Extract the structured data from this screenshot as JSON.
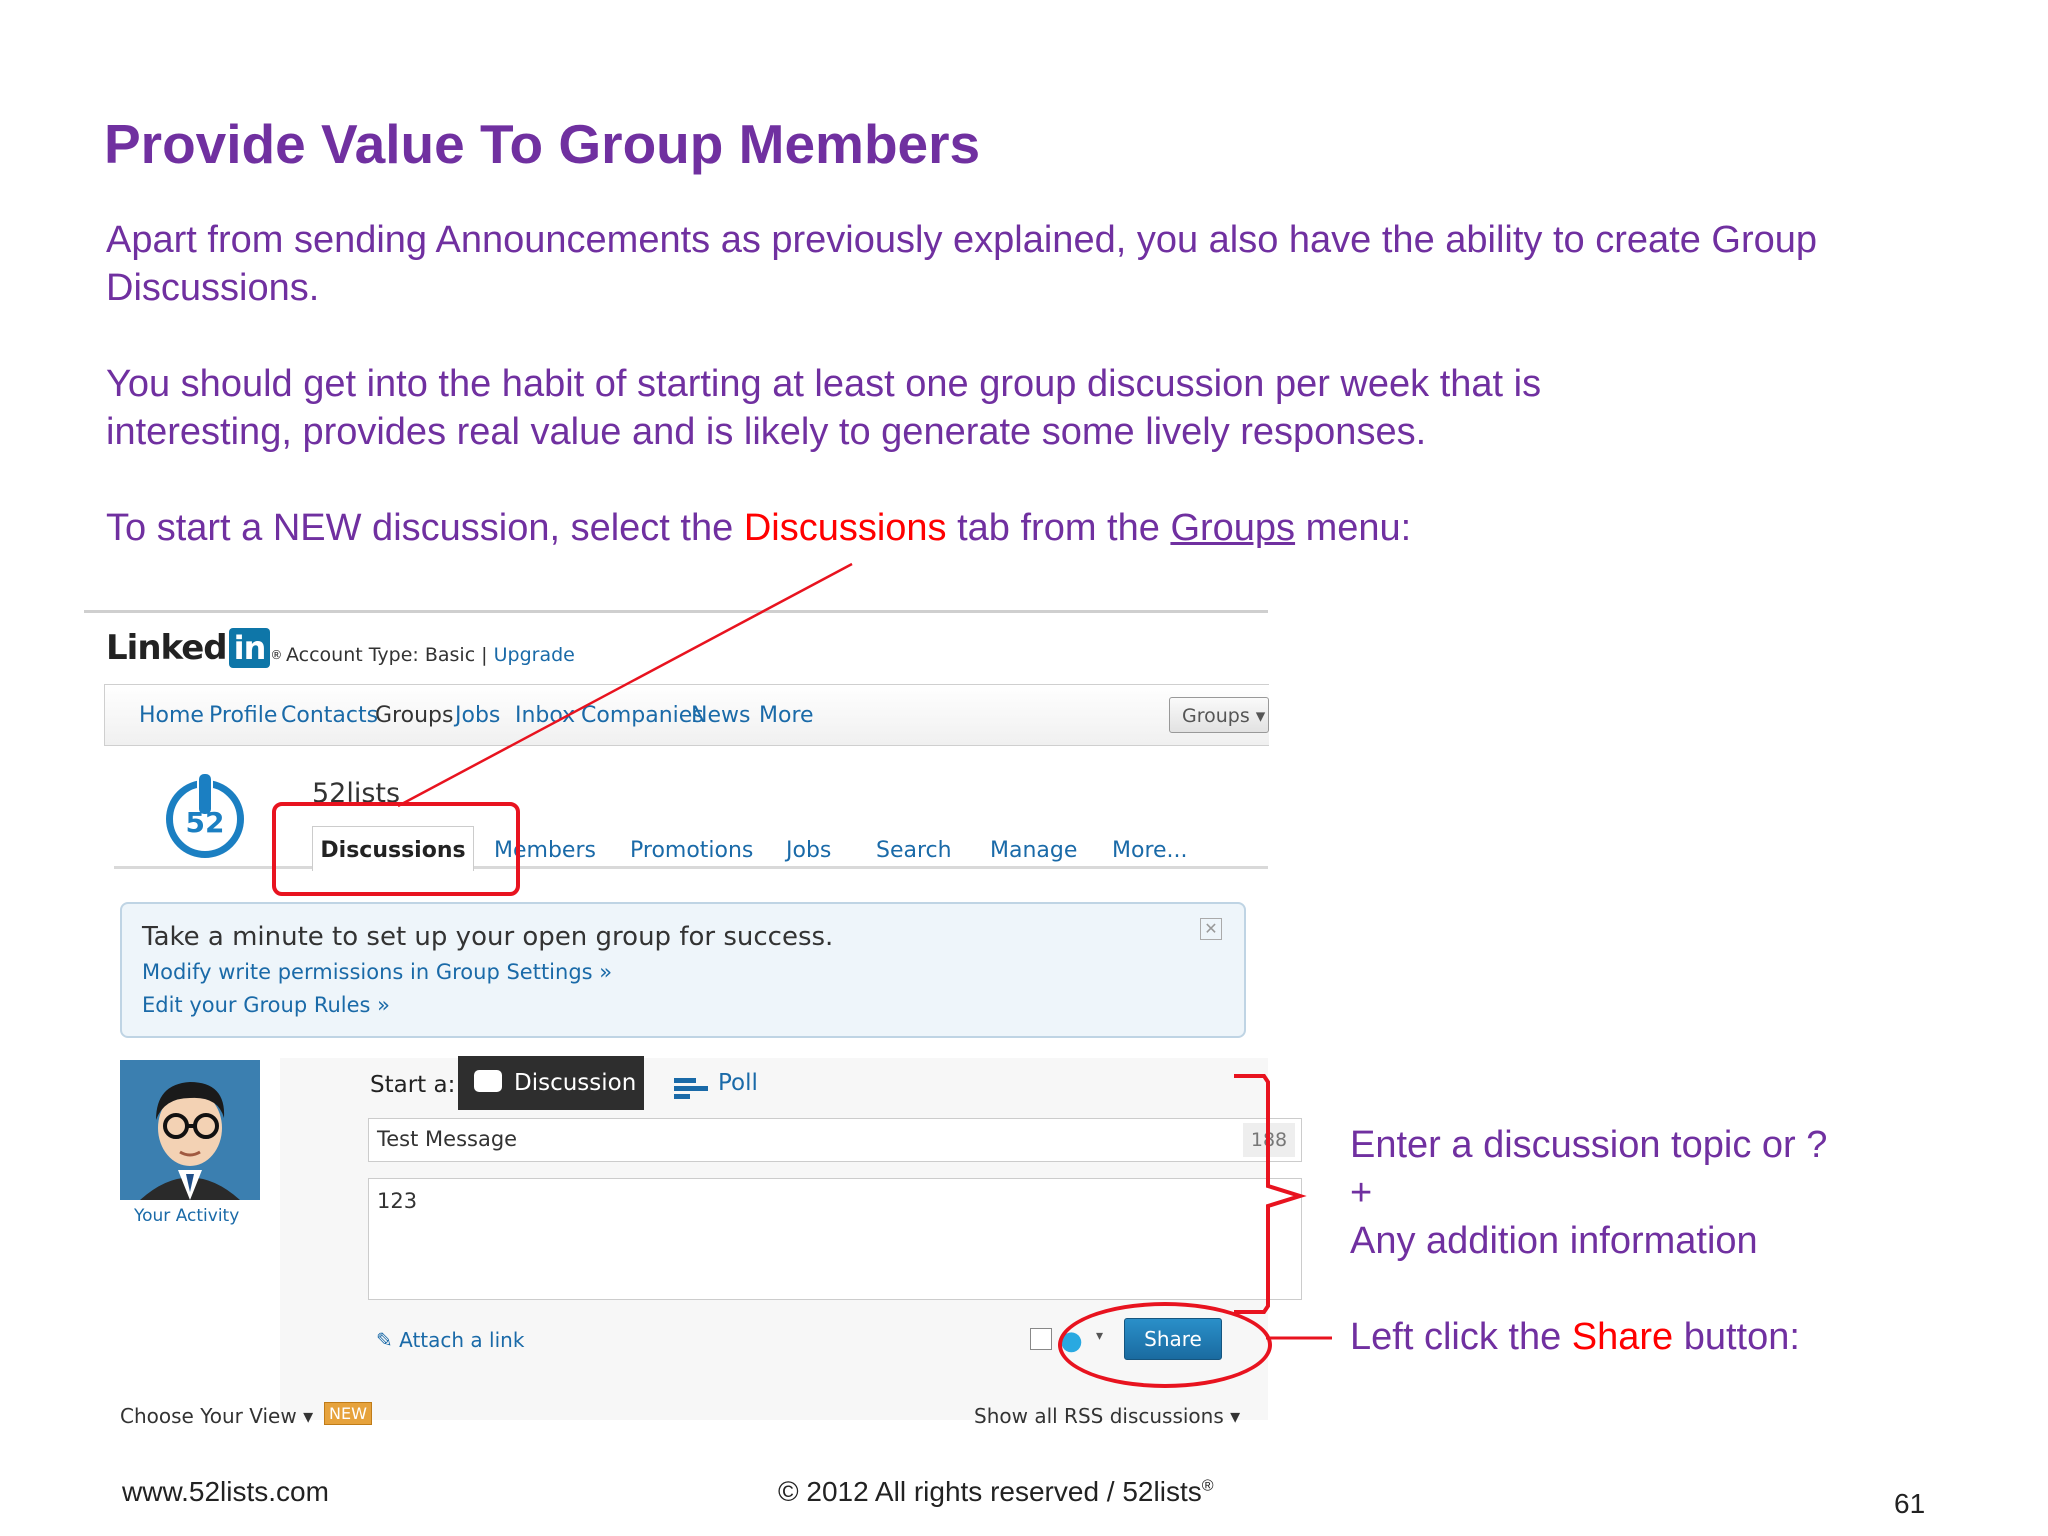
{
  "slide": {
    "title": "Provide Value To Group Members",
    "para1": "Apart from sending Announcements as previously explained, you also have the ability to create Group Discussions.",
    "para2_line1": "You should get into the habit of starting at least one group discussion per week that is",
    "para2_line2": "interesting, provides real value and is likely to generate some lively responses.",
    "para3": {
      "pre": "To start a NEW discussion, select the ",
      "highlight": "Discussions",
      "mid": " tab from the ",
      "link": "Groups",
      "post": " menu:"
    }
  },
  "linkedin": {
    "logo_text": "Linked",
    "logo_in": "in",
    "logo_reg": "®",
    "account_prefix": "Account Type: Basic | ",
    "upgrade": "Upgrade",
    "nav": [
      "Home",
      "Profile",
      "Contacts",
      "Groups",
      "Jobs",
      "Inbox",
      "Companies",
      "News",
      "More"
    ],
    "search_scope": "Groups ▾",
    "group_logo_number": "52",
    "group_name": "52lists",
    "tabs": [
      "Discussions",
      "Members",
      "Promotions",
      "Jobs",
      "Search",
      "Manage",
      "More..."
    ],
    "info_title": "Take a minute to set up your open group for success.",
    "info_link1": "Modify write permissions in Group Settings »",
    "info_link2": "Edit your Group Rules »",
    "your_activity": "Your Activity",
    "start_a": "Start a:",
    "discussion_btn": "Discussion",
    "poll_btn": "Poll",
    "topic_value": "Test Message",
    "topic_count": "188",
    "details_value": "123",
    "attach_link": "Attach a link",
    "share_btn": "Share",
    "choose_view": "Choose Your View ▾",
    "new_badge": "NEW",
    "rss": "Show all RSS discussions ▾"
  },
  "side_notes": {
    "line1": "Enter a discussion topic or ?",
    "plus": "+",
    "line2": "Any addition information",
    "share_pre": "Left click the ",
    "share_word": "Share",
    "share_post": " button:"
  },
  "footer": {
    "website": "www.52lists.com",
    "copyright": "© 2012 All rights reserved / 52lists",
    "reg": "®",
    "page_number": "61"
  },
  "colors": {
    "heading": "#7030a0",
    "highlight": "#ff0000",
    "annotation": "#e8131f",
    "linkedin_blue": "#0e76a8"
  }
}
